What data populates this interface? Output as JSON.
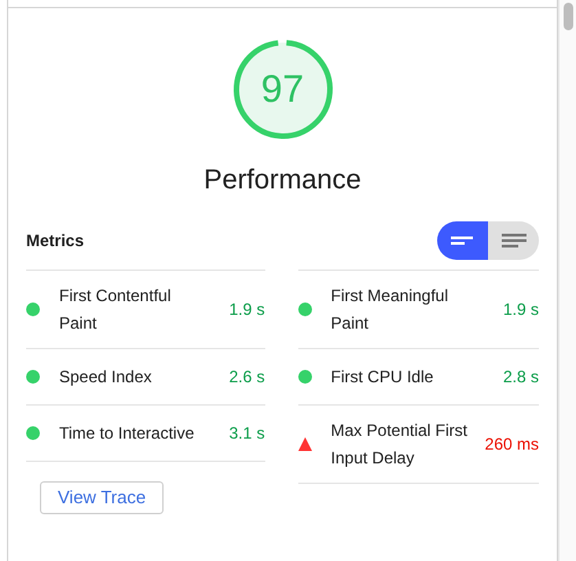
{
  "gauge": {
    "score": "97"
  },
  "category_title": "Performance",
  "metrics_header": {
    "title": "Metrics",
    "view_toggle": [
      {
        "kind": "compact",
        "selected": true
      },
      {
        "kind": "expanded",
        "selected": false
      }
    ]
  },
  "metrics": [
    {
      "name": "First Contentful Paint",
      "value": "1.9 s",
      "kind": "pass"
    },
    {
      "name": "First Meaningful Paint",
      "value": "1.9 s",
      "kind": "pass"
    },
    {
      "name": "Speed Index",
      "value": "2.6 s",
      "kind": "pass"
    },
    {
      "name": "First CPU Idle",
      "value": "2.8 s",
      "kind": "pass"
    },
    {
      "name": "Time to Interactive",
      "value": "3.1 s",
      "kind": "pass"
    },
    {
      "name": "Max Potential First Input Delay",
      "value": "260 ms",
      "kind": "fail"
    }
  ],
  "view_trace_button": "View Trace"
}
